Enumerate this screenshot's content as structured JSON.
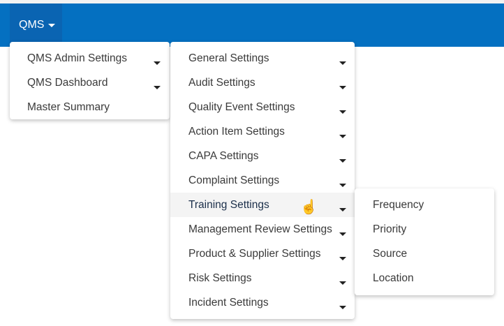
{
  "navbar": {
    "menu_label": "QMS"
  },
  "menu_main": {
    "items": [
      {
        "label": "QMS Admin Settings",
        "has_submenu": true
      },
      {
        "label": "QMS Dashboard",
        "has_submenu": true
      },
      {
        "label": "Master Summary",
        "has_submenu": false
      }
    ]
  },
  "menu_admin": {
    "items": [
      {
        "label": "General Settings"
      },
      {
        "label": "Audit Settings"
      },
      {
        "label": "Quality Event Settings"
      },
      {
        "label": "Action Item Settings"
      },
      {
        "label": "CAPA Settings"
      },
      {
        "label": "Complaint Settings"
      },
      {
        "label": "Training Settings"
      },
      {
        "label": "Management Review Settings"
      },
      {
        "label": "Product & Supplier Settings"
      },
      {
        "label": "Risk Settings"
      },
      {
        "label": "Incident Settings"
      }
    ],
    "active_index": 6
  },
  "menu_training": {
    "items": [
      {
        "label": "Frequency"
      },
      {
        "label": "Priority"
      },
      {
        "label": "Source"
      },
      {
        "label": "Location"
      }
    ]
  },
  "colors": {
    "navbar": "#0470c1",
    "navbar_active": "#0a64b2",
    "hover_row": "#f4f4f4"
  }
}
